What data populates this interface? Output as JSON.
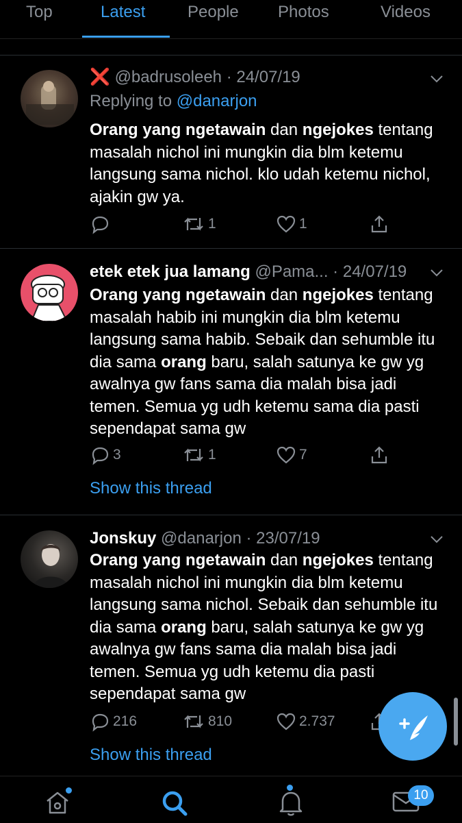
{
  "tabs": [
    {
      "label": "Top",
      "active": false
    },
    {
      "label": "Latest",
      "active": true
    },
    {
      "label": "People",
      "active": false
    },
    {
      "label": "Photos",
      "active": false
    },
    {
      "label": "Videos",
      "active": false
    }
  ],
  "tweets": [
    {
      "name_emoji": "❌",
      "handle": "@badrusoleeh",
      "date": "24/07/19",
      "replying_prefix": "Replying to",
      "replying_handle": "@danarjon",
      "body_bold1": "Orang yang ngetawain",
      "body_mid1": " dan ",
      "body_bold2": "ngejokes",
      "body_rest": " tentang masalah nichol ini mungkin dia blm ketemu langsung sama nichol. klo udah ketemu nichol, ajakin gw ya.",
      "replies": "",
      "retweets": "1",
      "likes": "1"
    },
    {
      "name": "etek etek jua lamang",
      "handle": "@Pama...",
      "date": "24/07/19",
      "body_bold1": "Orang yang ngetawain",
      "body_mid1": " dan ",
      "body_bold2": "ngejokes",
      "body_part2": " tentang masalah habib ini mungkin dia blm ketemu langsung sama habib. Sebaik dan sehumble itu dia sama ",
      "body_bold3": "orang",
      "body_part3": " baru, salah satunya ke gw yg awalnya gw fans sama dia malah bisa jadi temen. Semua yg udh ketemu sama dia pasti sependapat sama gw",
      "replies": "3",
      "retweets": "1",
      "likes": "7",
      "show_thread": "Show this thread"
    },
    {
      "name": "Jonskuy",
      "handle": "@danarjon",
      "date": "23/07/19",
      "body_bold1": "Orang yang ngetawain",
      "body_mid1": " dan ",
      "body_bold2": "ngejokes",
      "body_part2": " tentang masalah nichol ini mungkin dia blm ketemu langsung sama nichol. Sebaik dan sehumble itu dia sama ",
      "body_bold3": "orang",
      "body_part3": " baru, salah satunya ke gw yg awalnya gw fans sama dia malah bisa jadi temen. Semua yg udh ketemu dia pasti sependapat sama gw",
      "replies": "216",
      "retweets": "810",
      "likes": "2.737",
      "show_thread": "Show this thread"
    }
  ],
  "bottom_nav": {
    "items": [
      "home-icon",
      "search-icon",
      "bell-icon",
      "mail-icon"
    ],
    "mail_badge": "10"
  },
  "colors": {
    "accent": "#3b9ff0",
    "muted": "#8a8f96",
    "background": "#000000",
    "error_red": "#e0245e"
  }
}
